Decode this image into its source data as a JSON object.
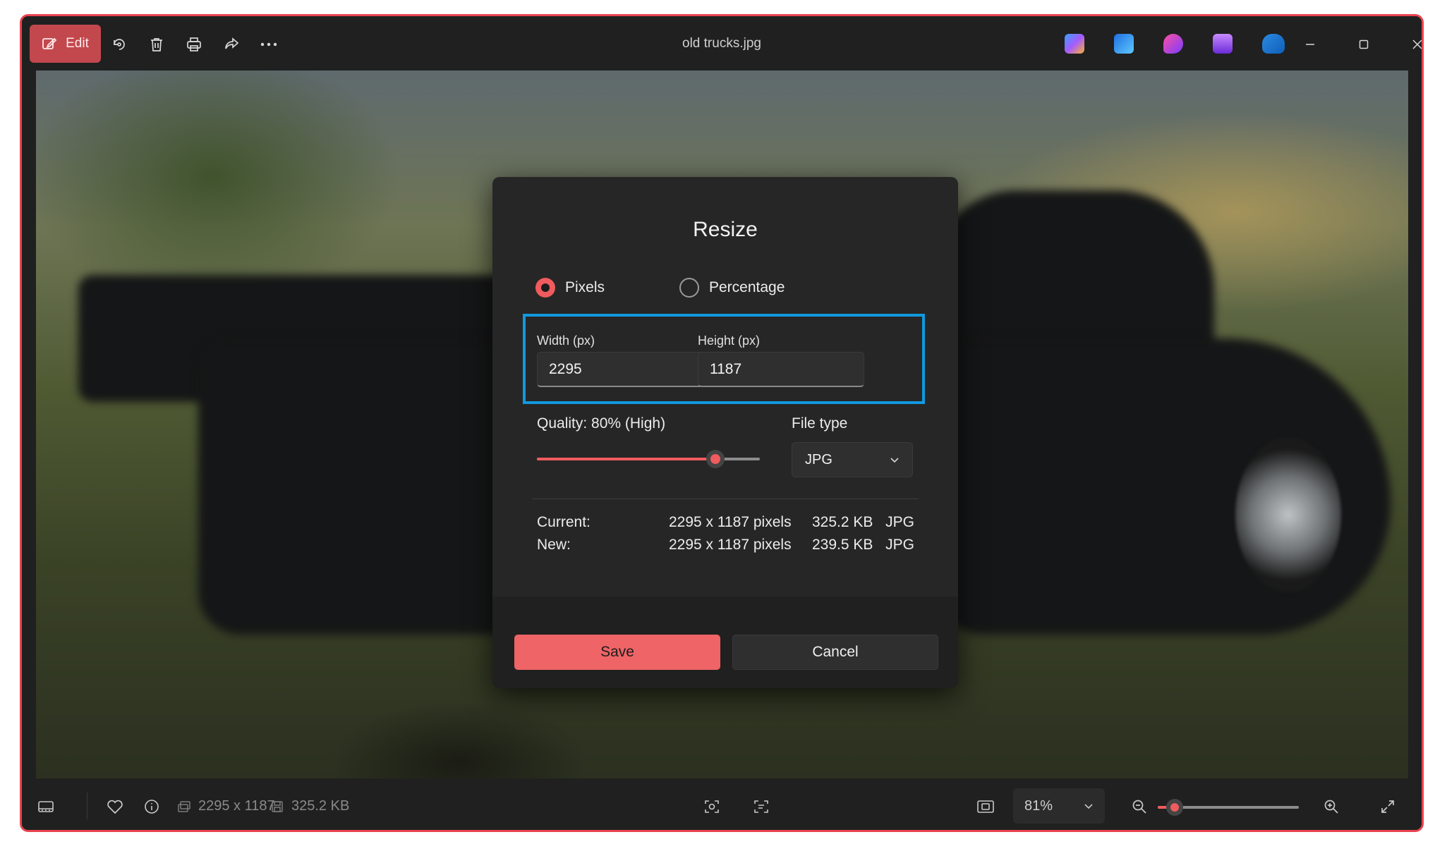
{
  "window": {
    "title": "old trucks.jpg",
    "accent_color": "#e8434f"
  },
  "toolbar": {
    "edit_label": "Edit",
    "icons": [
      "edit-icon",
      "rotate-icon",
      "delete-icon",
      "print-icon",
      "share-icon",
      "more-icon"
    ],
    "app_icons": [
      "copilot-icon",
      "designer-icon",
      "clipchamp-icon",
      "video-editor-icon",
      "onedrive-icon"
    ]
  },
  "dialog": {
    "title": "Resize",
    "mode_options": [
      {
        "label": "Pixels",
        "selected": true
      },
      {
        "label": "Percentage",
        "selected": false
      }
    ],
    "width_label": "Width  (px)",
    "width_value": "2295",
    "height_label": "Height  (px)",
    "height_value": "1187",
    "quality_label": "Quality: 80% (High)",
    "quality_value": 80,
    "filetype_label": "File type",
    "filetype_value": "JPG",
    "current": {
      "label": "Current:",
      "pixels": "2295 x 1187 pixels",
      "size": "325.2 KB",
      "type": "JPG"
    },
    "new": {
      "label": "New:",
      "pixels": "2295 x 1187 pixels",
      "size": "239.5 KB",
      "type": "JPG"
    },
    "save_label": "Save",
    "cancel_label": "Cancel",
    "accent_color": "#ef6466",
    "focus_border_color": "#1199dd"
  },
  "statusbar": {
    "dimensions": "2295 x 1187",
    "file_size": "325.2 KB",
    "zoom_value": "81%",
    "zoom_level": 0.12
  }
}
